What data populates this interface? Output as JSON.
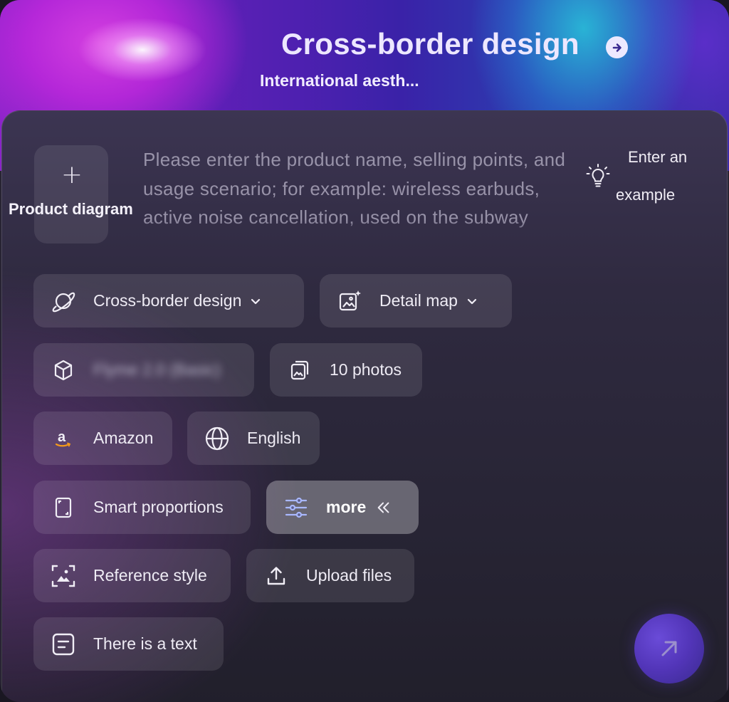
{
  "header": {
    "title": "Cross-border design",
    "subtitle": "International aesth..."
  },
  "upload": {
    "plus": "+",
    "label": "Product diagram"
  },
  "prompt": {
    "placeholder": "Please enter the product name, selling points, and usage scenario; for example: wireless earbuds, active noise cancellation, used on the subway"
  },
  "example": {
    "line1": "Enter an",
    "line2": "example"
  },
  "chips": {
    "category": "Cross-border design",
    "output_type": "Detail map",
    "model": "Flyme 2.0 (Basic)",
    "count": "10 photos",
    "platform": "Amazon",
    "language": "English",
    "ratio": "Smart proportions",
    "more": "more",
    "reference": "Reference style",
    "upload_files": "Upload files",
    "text": "There is a text"
  },
  "icons": {
    "category": "planet-icon",
    "output_type": "image-sparkle-icon",
    "model": "cube-icon",
    "count": "photos-icon",
    "platform": "amazon-icon",
    "language": "globe-icon",
    "ratio": "aspect-ratio-icon",
    "more": "sliders-icon",
    "reference": "scan-image-icon",
    "upload_files": "upload-icon",
    "text": "text-box-icon",
    "send": "arrow-up-right-icon",
    "example": "lightbulb-icon"
  },
  "colors": {
    "accent_send": "#5235b8",
    "more_icon": "#a9b8ff"
  }
}
